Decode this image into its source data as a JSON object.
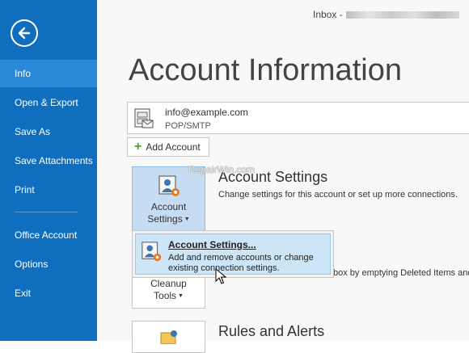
{
  "sidebar": {
    "items": [
      {
        "label": "Info"
      },
      {
        "label": "Open & Export"
      },
      {
        "label": "Save As"
      },
      {
        "label": "Save Attachments"
      },
      {
        "label": "Print"
      },
      {
        "label": "Office Account"
      },
      {
        "label": "Options"
      },
      {
        "label": "Exit"
      }
    ]
  },
  "window": {
    "title_prefix": "Inbox -"
  },
  "page": {
    "title": "Account Information"
  },
  "account": {
    "email": "info@example.com",
    "type": "POP/SMTP"
  },
  "add_account": {
    "label": "Add Account"
  },
  "account_settings": {
    "tile_line1": "Account",
    "tile_line2": "Settings",
    "title": "Account Settings",
    "description": "Change settings for this account or set up more connections."
  },
  "cleanup": {
    "tile_line1": "Cleanup",
    "tile_line2": "Tools",
    "description_fragment": "box by emptying Deleted Items and"
  },
  "rules": {
    "title": "Rules and Alerts"
  },
  "dropdown": {
    "item_title": "Account Settings...",
    "item_description": "Add and remove accounts or change existing connection settings."
  },
  "watermark": {
    "text": "RepairWin.com"
  },
  "colors": {
    "sidebar": "#106ebe",
    "sidebar_active": "#2b88d8",
    "highlight": "#cde6f7"
  }
}
